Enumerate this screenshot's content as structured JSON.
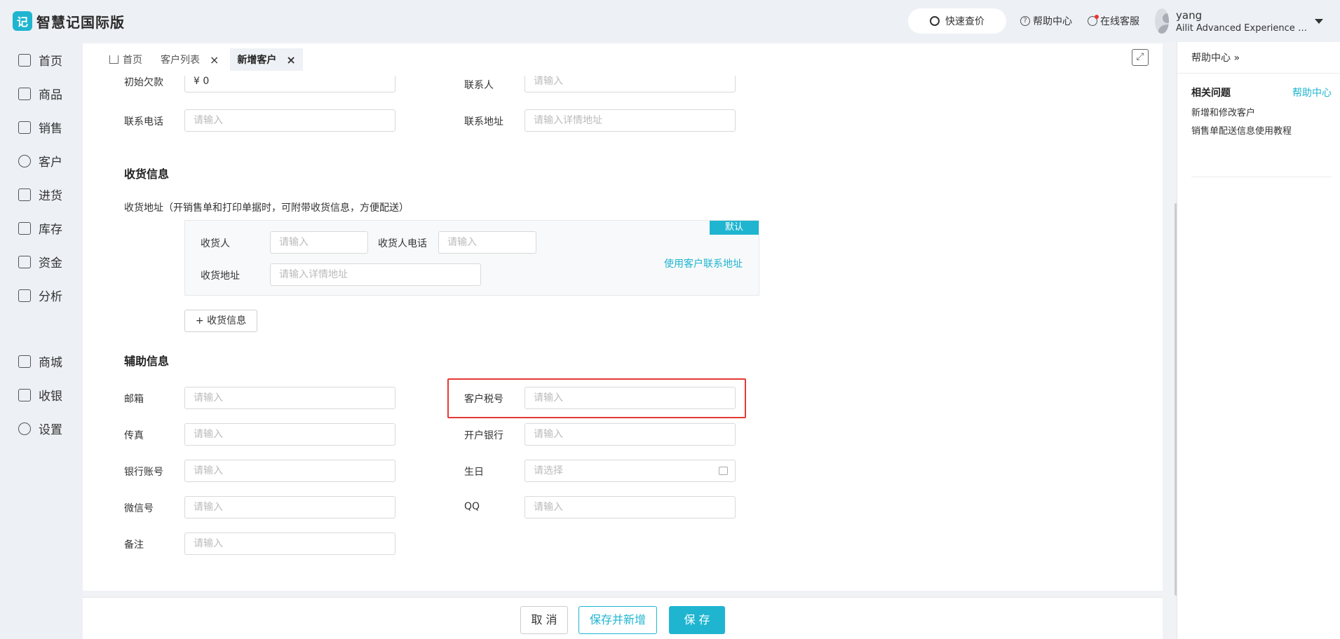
{
  "app": {
    "title": "智慧记国际版",
    "logo_glyph": "记"
  },
  "header": {
    "quick_price": "快速查价",
    "help": "帮助中心",
    "service": "在线客服",
    "user_name": "yang",
    "user_account": "Ailit Advanced Experience Acco..."
  },
  "sidebar": {
    "items": [
      {
        "label": "首页"
      },
      {
        "label": "商品"
      },
      {
        "label": "销售"
      },
      {
        "label": "客户"
      },
      {
        "label": "进货"
      },
      {
        "label": "库存"
      },
      {
        "label": "资金"
      },
      {
        "label": "分析"
      },
      {
        "label": "商城"
      },
      {
        "label": "收银"
      },
      {
        "label": "设置"
      }
    ]
  },
  "tabs": [
    {
      "label": "首页"
    },
    {
      "label": "客户列表"
    },
    {
      "label": "新增客户"
    }
  ],
  "form": {
    "initial_debt_label": "初始欠款",
    "initial_debt_value": "¥ 0",
    "contact_label": "联系人",
    "phone_label": "联系电话",
    "address_label": "联系地址",
    "placeholder": "请输入",
    "address_placeholder": "请输入详情地址",
    "select_placeholder": "请选择"
  },
  "shipping": {
    "title": "收货信息",
    "desc": "收货地址（开销售单和打印单据时，可附带收货信息，方便配送）",
    "default_tag": "默认",
    "receiver_label": "收货人",
    "receiver_phone_label": "收货人电话",
    "receiver_address_label": "收货地址",
    "use_contact_link": "使用客户联系地址",
    "add_button": "+ 收货信息"
  },
  "aux": {
    "title": "辅助信息",
    "email": "邮箱",
    "tax_no": "客户税号",
    "fax": "传真",
    "bank": "开户银行",
    "account": "银行账号",
    "birthday": "生日",
    "wechat": "微信号",
    "qq": "QQ",
    "remark": "备注"
  },
  "footer": {
    "cancel": "取 消",
    "save_new": "保存并新增",
    "save": "保 存"
  },
  "help_panel": {
    "head": "帮助中心 »",
    "title": "相关问题",
    "link": "帮助中心",
    "items": [
      "新增和修改客户",
      "销售单配送信息使用教程"
    ]
  },
  "colors": {
    "accent": "#1fb5d0",
    "highlight": "#e53935"
  }
}
